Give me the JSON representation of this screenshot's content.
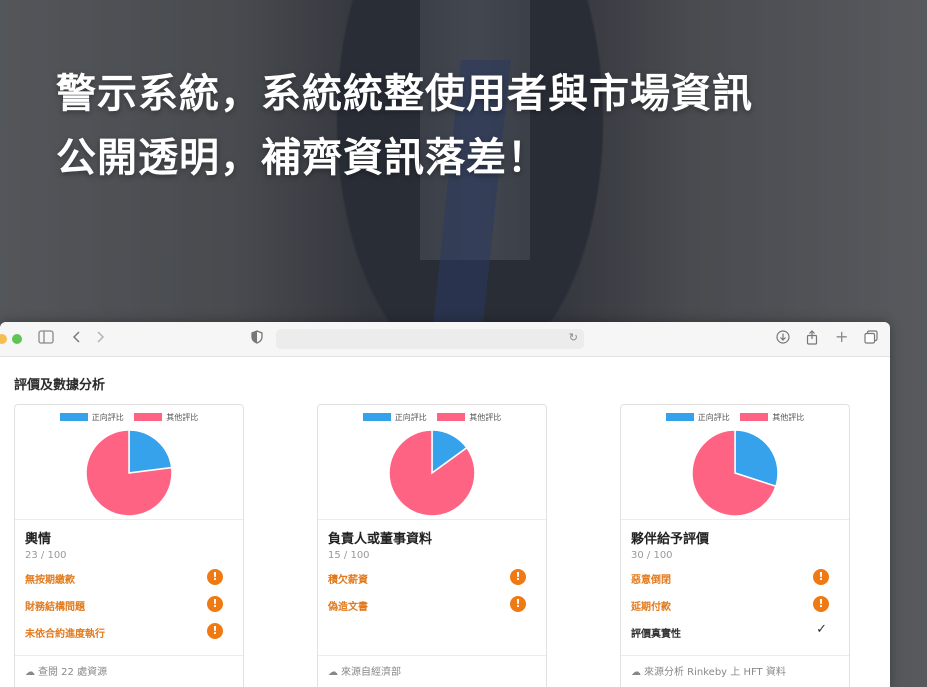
{
  "headline": {
    "line1": "警示系統，系統統整使用者與市場資訊",
    "line2": "公開透明，補齊資訊落差！"
  },
  "browser": {
    "icons": [
      "sidebar-icon",
      "back-icon",
      "forward-icon",
      "shield-icon",
      "reload-icon",
      "download-icon",
      "share-icon",
      "new-tab-icon",
      "tabs-icon"
    ]
  },
  "section_title": "評價及數據分析",
  "legend": {
    "positive": "正向評比",
    "other": "其他評比"
  },
  "colors": {
    "positive": "#36a2eb",
    "other": "#ff6384",
    "warning": "#ef7a14"
  },
  "cards": [
    {
      "name": "輿情",
      "score": "23 / 100",
      "issues": [
        "無按期繳款",
        "財務結構問題",
        "未依合約進度執行"
      ],
      "source": "查閱 22 處資源"
    },
    {
      "name": "負責人或董事資料",
      "score": "15 / 100",
      "issues": [
        "積欠薪資",
        "偽造文書"
      ],
      "source": "來源自經濟部"
    },
    {
      "name": "夥伴給予評價",
      "score": "30 / 100",
      "issues": [
        "惡意倒閉",
        "延期付款"
      ],
      "verified": "評價真實性",
      "source": "來源分析 Rinkeby 上 HFT 資料"
    }
  ],
  "chart_data": [
    {
      "type": "pie",
      "categories": [
        "正向評比",
        "其他評比"
      ],
      "values": [
        23,
        77
      ]
    },
    {
      "type": "pie",
      "categories": [
        "正向評比",
        "其他評比"
      ],
      "values": [
        15,
        85
      ]
    },
    {
      "type": "pie",
      "categories": [
        "正向評比",
        "其他評比"
      ],
      "values": [
        30,
        70
      ]
    }
  ]
}
